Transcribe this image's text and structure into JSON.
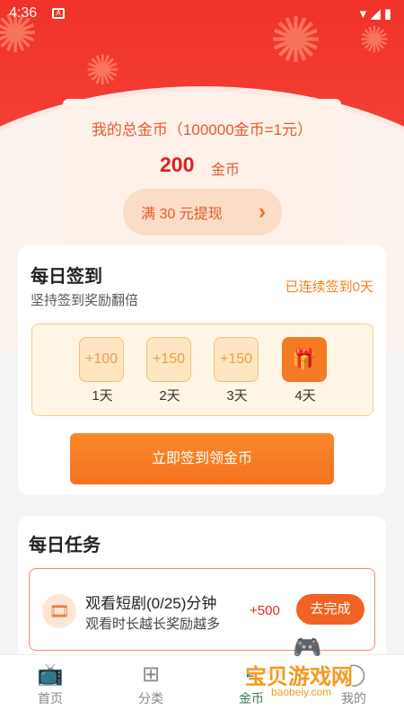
{
  "status_bar": {
    "time": "4:36",
    "notification_icon": "A",
    "system_icons": "▾◢▮"
  },
  "coins": {
    "total_label": "我的总金币（100000金币=1元）",
    "amount": "200",
    "unit": "金币",
    "withdraw_label": "满 30 元提现",
    "chevron": "›"
  },
  "daily_signin": {
    "title": "每日签到",
    "subtitle": "坚持签到奖励翻倍",
    "streak": "已连续签到0天",
    "days": [
      {
        "reward": "+100",
        "label": "1天"
      },
      {
        "reward": "+150",
        "label": "2天"
      },
      {
        "reward": "+150",
        "label": "3天"
      },
      {
        "reward": "",
        "label": "4天",
        "icon": "gift-icon"
      }
    ],
    "cta_label": "立即签到领金币"
  },
  "daily_tasks": {
    "title": "每日任务",
    "items": [
      {
        "icon": "film-icon",
        "name": "观看短剧(0/25)分钟",
        "desc": "观看时长越长奖励越多",
        "reward": "+500",
        "action": "去完成"
      }
    ]
  },
  "tab_bar": {
    "items": [
      {
        "label": "首页",
        "icon": "tv-icon"
      },
      {
        "label": "分类",
        "icon": "grid-icon"
      },
      {
        "label": "金币",
        "icon": "coin-icon",
        "active": true
      },
      {
        "label": "我的",
        "icon": "profile-icon"
      }
    ]
  },
  "watermark": {
    "title": "宝贝游戏网",
    "url": "baobeiy.com"
  },
  "colors": {
    "brand_red": "#f0322a",
    "accent_orange": "#f47a24",
    "active_tab": "#3a7d56"
  }
}
